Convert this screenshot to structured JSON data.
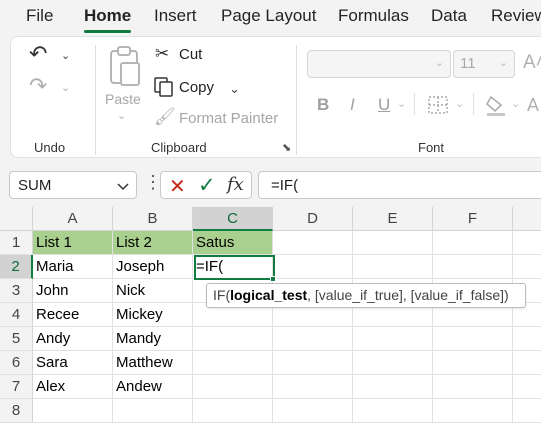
{
  "menu": {
    "tabs": [
      {
        "label": "File"
      },
      {
        "label": "Home"
      },
      {
        "label": "Insert"
      },
      {
        "label": "Page Layout"
      },
      {
        "label": "Formulas"
      },
      {
        "label": "Data"
      },
      {
        "label": "Review"
      }
    ],
    "active_tab": "Home"
  },
  "ribbon": {
    "undo_group": {
      "label": "Undo"
    },
    "clipboard_group": {
      "label": "Clipboard",
      "paste_label": "Paste",
      "cut_label": "Cut",
      "copy_label": "Copy",
      "format_painter_label": "Format Painter"
    },
    "font_group": {
      "label": "Font",
      "font_size": "11",
      "bold": "B",
      "italic": "I",
      "underline": "U"
    }
  },
  "formula_bar": {
    "name_box": "SUM",
    "formula": "=IF("
  },
  "grid": {
    "columns": [
      "A",
      "B",
      "C",
      "D",
      "E",
      "F"
    ],
    "rows": [
      "1",
      "2",
      "3",
      "4",
      "5",
      "6",
      "7",
      "8"
    ],
    "selected_column": "C",
    "selected_row": "2",
    "header_fill": "#a9d08e",
    "cells": {
      "A1": "List 1",
      "B1": "List 2",
      "C1": "Satus",
      "A2": "Maria",
      "B2": "Joseph",
      "C2": "=IF(",
      "A3": "John",
      "B3": "Nick",
      "A4": "Recee",
      "B4": "Mickey",
      "A5": "Andy",
      "B5": "Mandy",
      "A6": "Sara",
      "B6": "Matthew",
      "A7": "Alex",
      "B7": "Andew"
    }
  },
  "tooltip": {
    "func": "IF(",
    "arg1": "logical_test",
    "rest": ", [value_if_true], [value_if_false])"
  },
  "colors": {
    "accent": "#107c41"
  }
}
